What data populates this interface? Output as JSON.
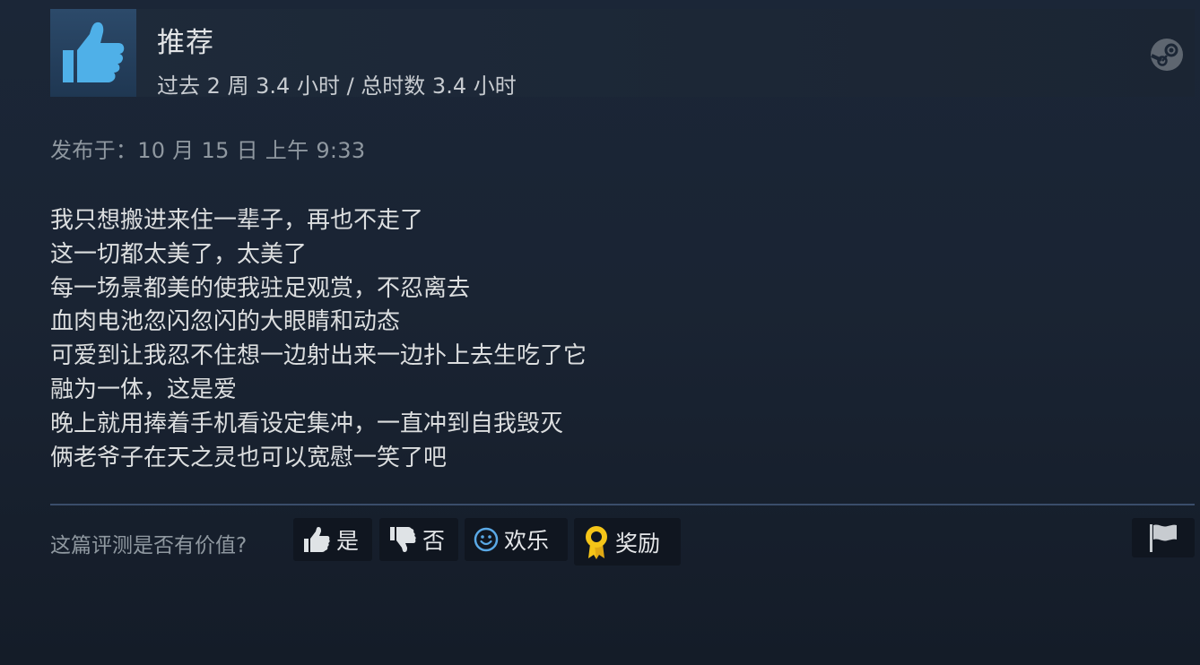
{
  "header": {
    "recommendation": "推荐",
    "hours": "过去 2 周 3.4 小时 / 总时数 3.4 小时"
  },
  "posted": "发布于：10 月 15 日 上午 9:33",
  "review_lines": [
    "我只想搬进来住一辈子，再也不走了",
    "这一切都太美了，太美了",
    "每一场景都美的使我驻足观赏，不忍离去",
    "血肉电池忽闪忽闪的大眼睛和动态",
    "可爱到让我忍不住想一边射出来一边扑上去生吃了它",
    "融为一体，这是爱",
    "晚上就用捧着手机看设定集冲，一直冲到自我毁灭",
    "俩老爷子在天之灵也可以宽慰一笑了吧"
  ],
  "footer": {
    "helpful_question": "这篇评测是否有价值?",
    "yes_label": "是",
    "no_label": "否",
    "funny_label": "欢乐",
    "award_label": "奖励"
  },
  "icons": {
    "recommend": "thumbs-up-icon",
    "platform": "steam-logo-icon",
    "yes": "thumbs-up-icon",
    "no": "thumbs-down-icon",
    "funny": "smiley-icon",
    "award": "award-ribbon-icon",
    "report": "flag-icon"
  },
  "colors": {
    "thumb_blue": "#4fb0e8",
    "award_gold": "#f5c518",
    "funny_blue": "#5aa9e6",
    "divider": "#3a4d6a"
  }
}
